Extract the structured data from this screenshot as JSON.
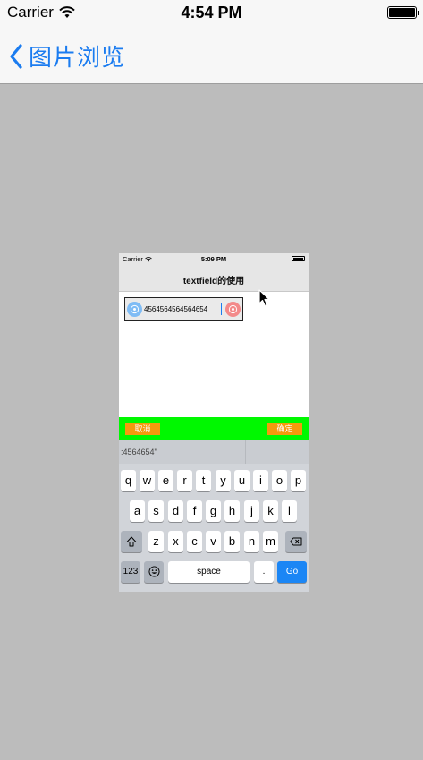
{
  "status_bar": {
    "carrier": "Carrier",
    "time": "4:54 PM",
    "battery_level": 1.0
  },
  "nav": {
    "back_title": "图片浏览",
    "accent_color": "#1b7cf0"
  },
  "embedded": {
    "status": {
      "carrier": "Carrier",
      "time": "5:09 PM"
    },
    "title": "textfield的使用",
    "textfield": {
      "value": "4564564564564654"
    },
    "accessory": {
      "cancel_label": "取消",
      "confirm_label": "确定",
      "bar_color": "#00f800",
      "button_color": "#f59a0c"
    },
    "predictions": [
      ":4564654\"",
      "",
      ""
    ],
    "keyboard": {
      "row1": [
        "q",
        "w",
        "e",
        "r",
        "t",
        "y",
        "u",
        "i",
        "o",
        "p"
      ],
      "row2": [
        "a",
        "s",
        "d",
        "f",
        "g",
        "h",
        "j",
        "k",
        "l"
      ],
      "row3": [
        "z",
        "x",
        "c",
        "v",
        "b",
        "n",
        "m"
      ],
      "numbers_label": "123",
      "space_label": "space",
      "period_label": ".",
      "go_label": "Go",
      "shift_icon": "shift-icon",
      "delete_icon": "delete-icon",
      "emoji_icon": "emoji-icon"
    }
  }
}
